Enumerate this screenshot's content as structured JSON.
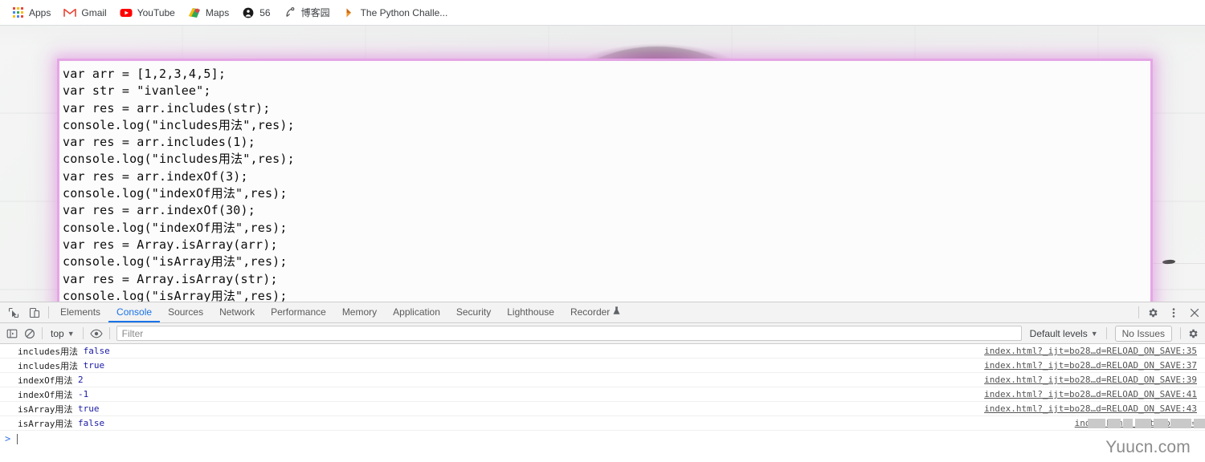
{
  "bookmarks": [
    {
      "label": "Apps",
      "icon": "apps-grid-icon"
    },
    {
      "label": "Gmail",
      "icon": "gmail-icon"
    },
    {
      "label": "YouTube",
      "icon": "youtube-icon"
    },
    {
      "label": "Maps",
      "icon": "maps-icon"
    },
    {
      "label": "56",
      "icon": "globe-person-icon"
    },
    {
      "label": "博客园",
      "icon": "cnblogs-icon"
    },
    {
      "label": "The Python Challe...",
      "icon": "python-challenge-icon"
    }
  ],
  "page": {
    "code": "var arr = [1,2,3,4,5];\nvar str = \"ivanlee\";\nvar res = arr.includes(str);\nconsole.log(\"includes用法\",res);\nvar res = arr.includes(1);\nconsole.log(\"includes用法\",res);\nvar res = arr.indexOf(3);\nconsole.log(\"indexOf用法\",res);\nvar res = arr.indexOf(30);\nconsole.log(\"indexOf用法\",res);\nvar res = Array.isArray(arr);\nconsole.log(\"isArray用法\",res);\nvar res = Array.isArray(str);\nconsole.log(\"isArray用法\",res);"
  },
  "devtools": {
    "left_buttons": [
      {
        "name": "inspect-element-icon",
        "title": "Inspect element"
      },
      {
        "name": "device-toolbar-icon",
        "title": "Toggle device toolbar"
      }
    ],
    "tabs": [
      {
        "label": "Elements",
        "active": false
      },
      {
        "label": "Console",
        "active": true
      },
      {
        "label": "Sources",
        "active": false
      },
      {
        "label": "Network",
        "active": false
      },
      {
        "label": "Performance",
        "active": false
      },
      {
        "label": "Memory",
        "active": false
      },
      {
        "label": "Application",
        "active": false
      },
      {
        "label": "Security",
        "active": false
      },
      {
        "label": "Lighthouse",
        "active": false
      },
      {
        "label": "Recorder",
        "active": false,
        "badge": "experiment-flask-icon"
      }
    ],
    "right_buttons": [
      {
        "name": "settings-gear-icon"
      },
      {
        "name": "more-options-icon"
      },
      {
        "name": "close-devtools-icon"
      }
    ],
    "filterbar": {
      "sidebar_toggle": "console-sidebar-icon",
      "clear_console": "clear-console-icon",
      "context_selector": "top",
      "live_expression": "eye-icon",
      "filter_placeholder": "Filter",
      "filter_value": "",
      "levels_label": "Default levels",
      "issues_label": "No Issues",
      "console_settings": "console-settings-gear-icon"
    },
    "messages": [
      {
        "text": "includes用法 ",
        "value": "false",
        "source": "index.html?_ijt=bo28…d=RELOAD_ON_SAVE:35",
        "redacted": false
      },
      {
        "text": "includes用法 ",
        "value": "true",
        "source": "index.html?_ijt=bo28…d=RELOAD_ON_SAVE:37",
        "redacted": false
      },
      {
        "text": "indexOf用法 ",
        "value": "2",
        "source": "index.html?_ijt=bo28…d=RELOAD_ON_SAVE:39",
        "redacted": false
      },
      {
        "text": "indexOf用法 ",
        "value": "-1",
        "source": "index.html?_ijt=bo28…d=RELOAD_ON_SAVE:41",
        "redacted": false
      },
      {
        "text": "isArray用法 ",
        "value": "true",
        "source": "index.html?_ijt=bo28…d=RELOAD_ON_SAVE:43",
        "redacted": false
      },
      {
        "text": "isArray用法 ",
        "value": "false",
        "source": "index.html?_ijt=bo28…d=",
        "redacted": true
      }
    ],
    "prompt": {
      "arrow": ">",
      "value": ""
    }
  },
  "watermark": {
    "text": "Yuucn.com"
  },
  "colors": {
    "accent": "#1a73e8",
    "console_value": "#1a1aa6",
    "code_glow": "#e5a4e5",
    "devtools_bg": "#f3f3f3"
  }
}
